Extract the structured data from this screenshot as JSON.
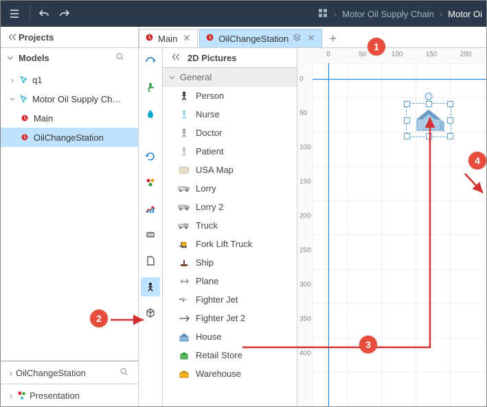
{
  "topbar": {
    "breadcrumb_project": "Motor Oil Supply Chain",
    "breadcrumb_current": "Motor Oi"
  },
  "projects_panel": {
    "title": "Projects",
    "models_section_title": "Models",
    "tree": {
      "q1_label": "q1",
      "project_label": "Motor Oil Supply Ch…",
      "main_label": "Main",
      "oilchange_label": "OilChangeStation"
    }
  },
  "properties_panel": {
    "title": "OilChangeStation"
  },
  "presentation_panel": {
    "title": "Presentation"
  },
  "tabs": {
    "main_label": "Main",
    "oilchange_label": "OilChangeStation"
  },
  "pictures_panel": {
    "title": "2D Pictures",
    "group_general": "General",
    "items": {
      "person": "Person",
      "nurse": "Nurse",
      "doctor": "Doctor",
      "patient": "Patient",
      "usamap": "USA Map",
      "lorry": "Lorry",
      "lorry2": "Lorry 2",
      "truck": "Truck",
      "forklift": "Fork Lift Truck",
      "ship": "Ship",
      "plane": "Plane",
      "fighter": "Fighter Jet",
      "fighter2": "Fighter Jet 2",
      "house": "House",
      "retail": "Retail Store",
      "warehouse": "Warehouse"
    }
  },
  "ruler": {
    "h": {
      "t0": "0",
      "t50": "50",
      "t100": "100",
      "t150": "150",
      "t200": "200"
    },
    "v": {
      "t0": "0",
      "t50": "50",
      "t100": "100",
      "t150": "150",
      "t200": "200",
      "t250": "250",
      "t300": "300",
      "t350": "350",
      "t400": "400"
    }
  },
  "badges": {
    "b1": "1",
    "b2": "2",
    "b3": "3",
    "b4": "4"
  }
}
